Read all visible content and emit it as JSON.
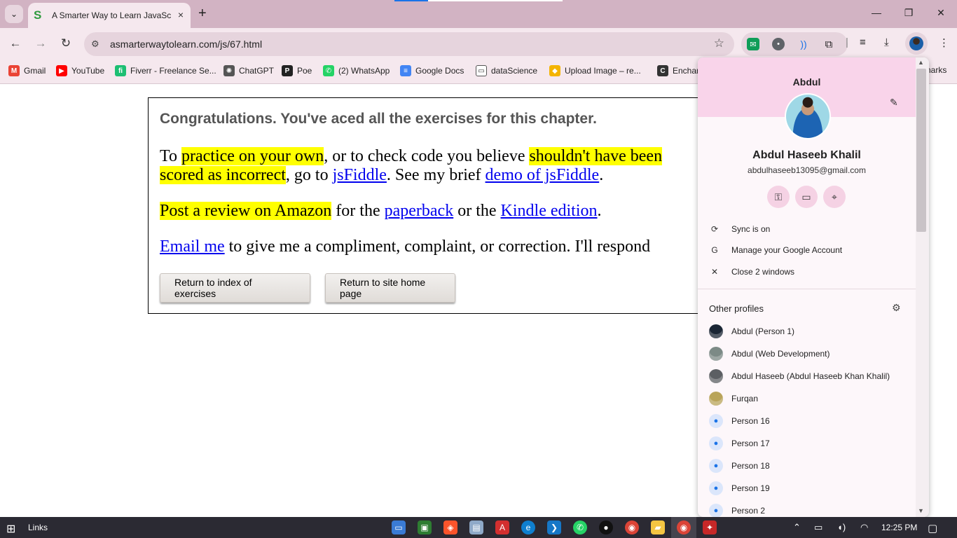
{
  "browser": {
    "tab": {
      "favicon": "S",
      "title": "A Smarter Way to Learn JavaScript",
      "close_icon": "×"
    },
    "new_tab": "+",
    "window_controls": {
      "minimize": "—",
      "restore": "❐",
      "close": "✕"
    },
    "url": "asmarterwaytolearn.com/js/67.html"
  },
  "bookmarks": [
    {
      "label": "Gmail",
      "icon": "M",
      "color": "#ea4335"
    },
    {
      "label": "YouTube",
      "icon": "▶",
      "color": "#ff0000"
    },
    {
      "label": "Fiverr - Freelance Se...",
      "icon": "fi",
      "color": "#1dbf73"
    },
    {
      "label": "ChatGPT",
      "icon": "✺",
      "color": "#555555"
    },
    {
      "label": "Poe",
      "icon": "P",
      "color": "#222222"
    },
    {
      "label": "(2) WhatsApp",
      "icon": "✆",
      "color": "#25d366"
    },
    {
      "label": "Google Docs",
      "icon": "≡",
      "color": "#4285f4"
    },
    {
      "label": "dataScience",
      "icon": "▭",
      "color": "#ffffff"
    },
    {
      "label": "Upload Image – re...",
      "icon": "◆",
      "color": "#f4b400"
    },
    {
      "label": "Enchar",
      "icon": "C",
      "color": "#333333"
    }
  ],
  "bookmarks_overflow": "narks",
  "page": {
    "congrats": "Congratulations. You've aced all the exercises for this chapter.",
    "p1": {
      "a": "To ",
      "hl1": "practice on your own",
      "b": ", or to check code you believe ",
      "hl2": "shouldn't have been",
      "hl3": "scored as incorrect",
      "c": ", go to ",
      "link1": "jsFiddle",
      "d": ". See my brief ",
      "link2": "demo of jsFiddle",
      "e": "."
    },
    "p2": {
      "hl": "Post a review on Amazon",
      "a": " for the ",
      "link1": "paperback",
      "b": " or the ",
      "link2": "Kindle edition",
      "c": "."
    },
    "p3": {
      "link": "Email me",
      "a": " to give me a compliment, complaint, or correction. I'll respond"
    },
    "buttons": {
      "index": "Return to index of exercises",
      "home": "Return to site home page"
    }
  },
  "profile_menu": {
    "header_name": "Abdul",
    "full_name": "Abdul Haseeb Khalil",
    "email": "abdulhaseeb13095@gmail.com",
    "quick_icons": [
      "key-icon",
      "card-icon",
      "location-icon"
    ],
    "items": [
      {
        "label": "Sync is on",
        "icon": "⟳"
      },
      {
        "label": "Manage your Google Account",
        "icon": "G"
      },
      {
        "label": "Close 2 windows",
        "icon": "✕"
      }
    ],
    "other_profiles_title": "Other profiles",
    "profiles": [
      {
        "label": "Abdul (Person 1)",
        "kind": "photo",
        "color": "#1b2635"
      },
      {
        "label": "Abdul (Web Development)",
        "kind": "photo",
        "color": "#7c8a86"
      },
      {
        "label": "Abdul Haseeb (Abdul Haseeb Khan Khalil)",
        "kind": "photo",
        "color": "#5c5f63"
      },
      {
        "label": "Furqan",
        "kind": "photo",
        "color": "#b9a45a"
      },
      {
        "label": "Person 16",
        "kind": "person"
      },
      {
        "label": "Person 17",
        "kind": "person"
      },
      {
        "label": "Person 18",
        "kind": "person"
      },
      {
        "label": "Person 19",
        "kind": "person"
      },
      {
        "label": "Person 2",
        "kind": "person"
      }
    ]
  },
  "taskbar": {
    "links": "Links",
    "clock": "12:25 PM"
  }
}
